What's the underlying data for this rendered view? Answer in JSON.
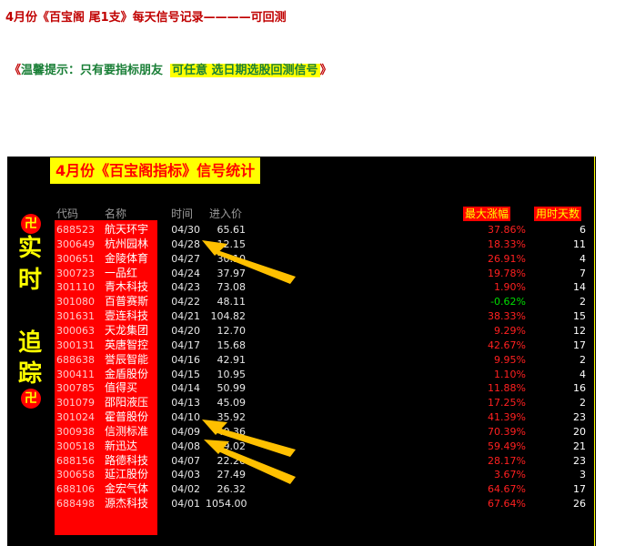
{
  "header": {
    "line1": "4月份《百宝阁  尾1支》每天信号记录————可回测",
    "line2_open": "《",
    "line2_tip": "温馨提示：只有要指标朋友",
    "line2_highlight": "可任意 选日期选股回测信号",
    "line2_close": "》"
  },
  "panel": {
    "title": "4月份《百宝阁指标》信号统计",
    "side_emblem": "卍",
    "side_chars": [
      "实",
      "时",
      "追",
      "踪"
    ]
  },
  "columns": {
    "code": "代码",
    "name": "名称",
    "date": "时间",
    "price": "进入价",
    "max_gain": "最大涨幅",
    "days": "用时天数"
  },
  "rows": [
    {
      "code": "688523",
      "name": "航天环宇",
      "date": "04/30",
      "price": "65.61",
      "max_gain": "37.86%",
      "days": "6"
    },
    {
      "code": "300649",
      "name": "杭州园林",
      "date": "04/28",
      "price": "12.15",
      "max_gain": "18.33%",
      "days": "11"
    },
    {
      "code": "300651",
      "name": "金陵体育",
      "date": "04/27",
      "price": "30.10",
      "max_gain": "26.91%",
      "days": "4"
    },
    {
      "code": "300723",
      "name": "一品红",
      "date": "04/24",
      "price": "37.97",
      "max_gain": "19.78%",
      "days": "7"
    },
    {
      "code": "301110",
      "name": "青木科技",
      "date": "04/23",
      "price": "73.08",
      "max_gain": "1.90%",
      "days": "14"
    },
    {
      "code": "301080",
      "name": "百普赛斯",
      "date": "04/22",
      "price": "48.11",
      "max_gain": "-0.62%",
      "days": "2"
    },
    {
      "code": "301631",
      "name": "壹连科技",
      "date": "04/21",
      "price": "104.82",
      "max_gain": "38.33%",
      "days": "15"
    },
    {
      "code": "300063",
      "name": "天龙集团",
      "date": "04/20",
      "price": "12.70",
      "max_gain": "9.29%",
      "days": "12"
    },
    {
      "code": "300131",
      "name": "英唐智控",
      "date": "04/17",
      "price": "15.68",
      "max_gain": "42.67%",
      "days": "17"
    },
    {
      "code": "688638",
      "name": "誉辰智能",
      "date": "04/16",
      "price": "42.91",
      "max_gain": "9.95%",
      "days": "2"
    },
    {
      "code": "300411",
      "name": "金盾股份",
      "date": "04/15",
      "price": "10.95",
      "max_gain": "1.10%",
      "days": "4"
    },
    {
      "code": "300785",
      "name": "值得买",
      "date": "04/14",
      "price": "50.99",
      "max_gain": "11.88%",
      "days": "16"
    },
    {
      "code": "301079",
      "name": "邵阳液压",
      "date": "04/13",
      "price": "45.09",
      "max_gain": "17.25%",
      "days": "2"
    },
    {
      "code": "301024",
      "name": "霍普股份",
      "date": "04/10",
      "price": "35.92",
      "max_gain": "41.39%",
      "days": "23"
    },
    {
      "code": "300938",
      "name": "信测标准",
      "date": "04/09",
      "price": "40.36",
      "max_gain": "70.39%",
      "days": "20"
    },
    {
      "code": "300518",
      "name": "新迅达",
      "date": "04/08",
      "price": "19.02",
      "max_gain": "59.49%",
      "days": "21"
    },
    {
      "code": "688156",
      "name": "路德科技",
      "date": "04/07",
      "price": "22.26",
      "max_gain": "28.17%",
      "days": "23"
    },
    {
      "code": "300658",
      "name": "延江股份",
      "date": "04/03",
      "price": "27.49",
      "max_gain": "3.67%",
      "days": "3"
    },
    {
      "code": "688106",
      "name": "金宏气体",
      "date": "04/02",
      "price": "26.32",
      "max_gain": "64.67%",
      "days": "17"
    },
    {
      "code": "688498",
      "name": "源杰科技",
      "date": "04/01",
      "price": "1054.00",
      "max_gain": "67.64%",
      "days": "26"
    }
  ],
  "colors": {
    "header_red": "#c00000",
    "tip_green": "#1a7f37",
    "highlight_yellow": "#ffff00",
    "panel_bg": "#000000",
    "gain_red": "#ff2020",
    "loss_green": "#00dd00",
    "arrow": "#ffc000"
  }
}
